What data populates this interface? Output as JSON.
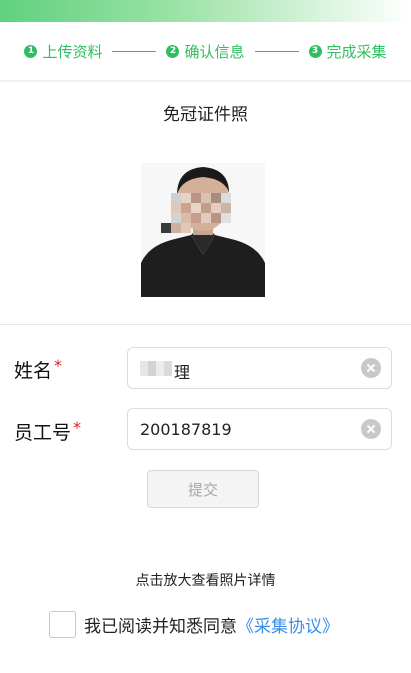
{
  "steps": [
    {
      "num": "1",
      "label": "上传资料"
    },
    {
      "num": "2",
      "label": "确认信息"
    },
    {
      "num": "3",
      "label": "完成采集"
    }
  ],
  "photo": {
    "title": "免冠证件照"
  },
  "form": {
    "name": {
      "label": "姓名",
      "required_mark": "*",
      "value_visible": "理"
    },
    "employee_id": {
      "label": "员工号",
      "required_mark": "*",
      "value": "200187819"
    }
  },
  "submit": {
    "label": "提交"
  },
  "hint": "点击放大查看照片详情",
  "agreement": {
    "text": "我已阅读并知悉同意",
    "link": "《采集协议》"
  },
  "colors": {
    "accent": "#2fbf62",
    "link": "#3a8ee6",
    "required": "#e02020"
  }
}
